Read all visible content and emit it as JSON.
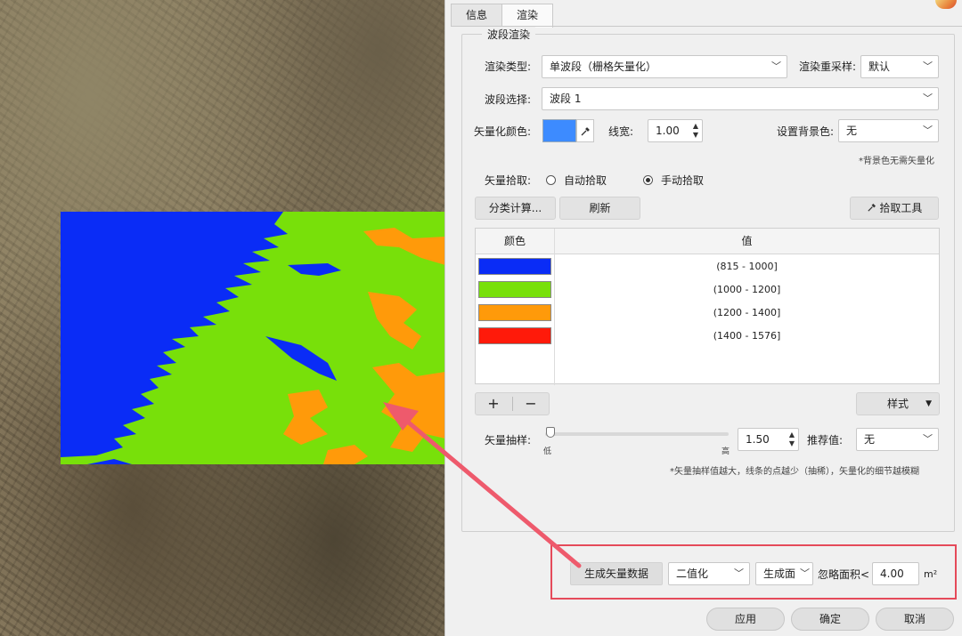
{
  "tabs": [
    {
      "label": "信息",
      "active": false
    },
    {
      "label": "渲染",
      "active": true
    }
  ],
  "group_title": "波段渲染",
  "render_type": {
    "label": "渲染类型:",
    "value": "单波段（栅格矢量化）"
  },
  "resample": {
    "label": "渲染重采样:",
    "value": "默认"
  },
  "band": {
    "label": "波段选择:",
    "value": "波段 1"
  },
  "vector_color": {
    "label": "矢量化颜色:",
    "color": "#3d8bff"
  },
  "line_width": {
    "label": "线宽:",
    "value": "1.00"
  },
  "background": {
    "label": "设置背景色:",
    "value": "无",
    "note": "*背景色无需矢量化"
  },
  "pick": {
    "label": "矢量拾取:",
    "auto": "自动拾取",
    "manual": "手动拾取",
    "selected": "manual"
  },
  "buttons": {
    "classify": "分类计算...",
    "refresh": "刷新",
    "pick_tool": "拾取工具"
  },
  "table": {
    "col_color": "颜色",
    "col_value": "值",
    "rows": [
      {
        "color": "#0a2cf6",
        "value": "(815 - 1000]"
      },
      {
        "color": "#78e00a",
        "value": "(1000 - 1200]"
      },
      {
        "color": "#ff9a0a",
        "value": "(1200 - 1400]"
      },
      {
        "color": "#ff1a0a",
        "value": "(1400 - 1576]"
      }
    ]
  },
  "table_tools": {
    "add": "+",
    "remove": "−",
    "style": "样式"
  },
  "sampling": {
    "label": "矢量抽样:",
    "low": "低",
    "high": "高",
    "value": "1.50",
    "slider_fraction": 0.0
  },
  "recommend": {
    "label": "推荐值:",
    "value": "无"
  },
  "sampling_note": "*矢量抽样值越大，线条的点越少（抽稀），矢量化的细节越模糊",
  "generate": {
    "button": "生成矢量数据",
    "mode": "二值化",
    "output": "生成面",
    "ignore_label": "忽略面积<",
    "ignore_value": "4.00",
    "unit": "m²"
  },
  "footer": {
    "apply": "应用",
    "ok": "确定",
    "cancel": "取消"
  },
  "colors": {
    "highlight": "#e54a5a",
    "arrow": "#ee5a6c"
  }
}
